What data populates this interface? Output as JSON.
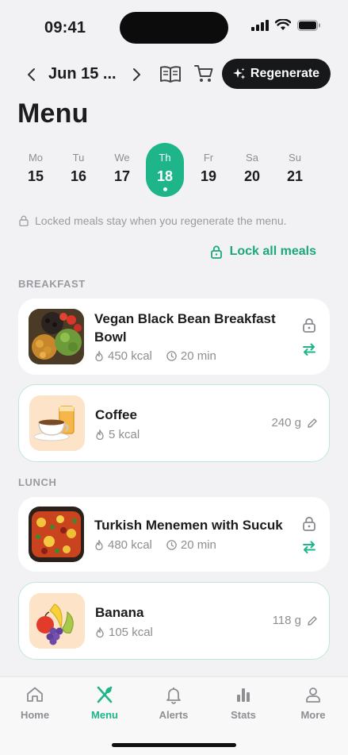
{
  "status": {
    "time": "09:41"
  },
  "header": {
    "date_range": "Jun 15 ...",
    "regenerate_label": "Regenerate",
    "title": "Menu"
  },
  "week": [
    {
      "dow": "Mo",
      "day": "15"
    },
    {
      "dow": "Tu",
      "day": "16"
    },
    {
      "dow": "We",
      "day": "17"
    },
    {
      "dow": "Th",
      "day": "18",
      "selected": true
    },
    {
      "dow": "Fr",
      "day": "19"
    },
    {
      "dow": "Sa",
      "day": "20"
    },
    {
      "dow": "Su",
      "day": "21"
    }
  ],
  "note": "Locked meals stay when you regenerate the menu.",
  "lock_all_label": "Lock all meals",
  "sections": {
    "breakfast": {
      "title": "BREAKFAST",
      "meals": [
        {
          "name_line1": "Vegan Black Bean Breakfast",
          "name_line2": "Bowl",
          "kcal": "450 kcal",
          "time": "20 min"
        },
        {
          "name": "Coffee",
          "kcal": "5 kcal",
          "amount": "240 g"
        }
      ]
    },
    "lunch": {
      "title": "LUNCH",
      "meals": [
        {
          "name": "Turkish Menemen with Sucuk",
          "kcal": "480 kcal",
          "time": "20 min"
        },
        {
          "name": "Banana",
          "kcal": "105 kcal",
          "amount": "118 g"
        }
      ]
    }
  },
  "tabs": [
    {
      "label": "Home",
      "icon": "home-icon"
    },
    {
      "label": "Menu",
      "icon": "utensils-icon",
      "active": true
    },
    {
      "label": "Alerts",
      "icon": "bell-icon"
    },
    {
      "label": "Stats",
      "icon": "bar-chart-icon"
    },
    {
      "label": "More",
      "icon": "person-icon"
    }
  ],
  "colors": {
    "accent": "#1db589",
    "dark_button": "#17181a",
    "background": "#f2f2f4"
  }
}
